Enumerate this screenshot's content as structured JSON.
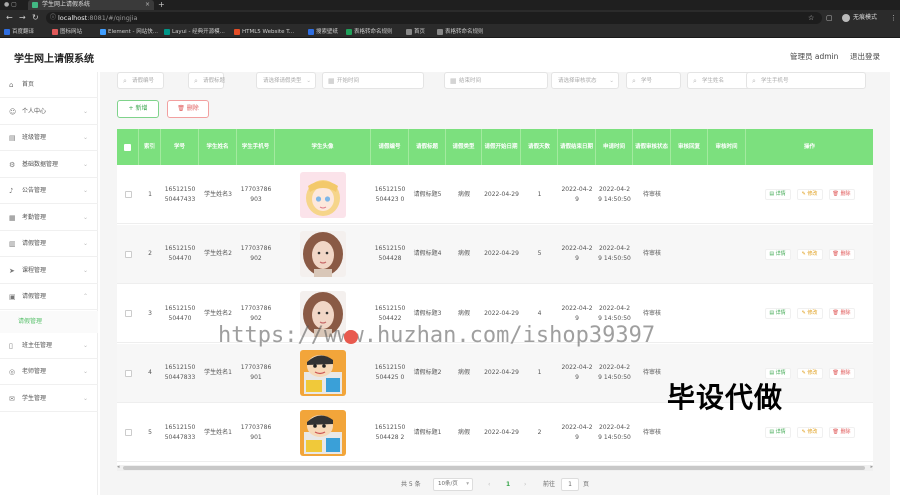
{
  "browser": {
    "tab_title": "学生网上请假系统",
    "tab_close": "×",
    "new_tab": "+",
    "url_host": "localhost",
    "url_path": ":8081/#/qingjia",
    "profile_label": "无痕模式",
    "bookmarks": [
      {
        "label": "百度翻译",
        "color": "#2f6ee0"
      },
      {
        "label": "图标网站",
        "color": "#e05a5a"
      },
      {
        "label": "Element - 网站快...",
        "color": "#409eff"
      },
      {
        "label": "Layui - 经典开源模...",
        "color": "#009688"
      },
      {
        "label": "HTML5 Website T...",
        "color": "#e44d26"
      },
      {
        "label": "搜索壁纸",
        "color": "#2f6ee0"
      },
      {
        "label": "表格转命名规则",
        "color": "#20a05a"
      },
      {
        "label": "首页",
        "color": "#888888"
      },
      {
        "label": "表格转命名规则",
        "color": "#888888"
      }
    ]
  },
  "header": {
    "title": "学生网上请假系统",
    "admin": "管理员 admin",
    "logout": "退出登录"
  },
  "sidebar": {
    "items": [
      {
        "label": "首页",
        "icon": "home-icon",
        "glyph": "⌂",
        "arrow": false
      },
      {
        "label": "个人中心",
        "icon": "user-icon",
        "glyph": "☺",
        "arrow": true
      },
      {
        "label": "班级管理",
        "icon": "clipboard-icon",
        "glyph": "▤",
        "arrow": true
      },
      {
        "label": "基础数据管理",
        "icon": "gear-icon",
        "glyph": "⚙",
        "arrow": true
      },
      {
        "label": "公告管理",
        "icon": "bell-icon",
        "glyph": "♪",
        "arrow": true
      },
      {
        "label": "考勤管理",
        "icon": "calendar-icon",
        "glyph": "▦",
        "arrow": true
      },
      {
        "label": "请假管理",
        "icon": "book-icon",
        "glyph": "▥",
        "arrow": true
      },
      {
        "label": "课程管理",
        "icon": "send-icon",
        "glyph": "➤",
        "arrow": true
      },
      {
        "label": "请假管理",
        "icon": "grid-icon",
        "glyph": "▣",
        "arrow": true,
        "expanded": true
      },
      {
        "label": "班主任管理",
        "icon": "document-icon",
        "glyph": "▯",
        "arrow": true
      },
      {
        "label": "老师管理",
        "icon": "chat-icon",
        "glyph": "◎",
        "arrow": true
      },
      {
        "label": "学生管理",
        "icon": "mail-icon",
        "glyph": "✉",
        "arrow": true
      }
    ],
    "submenu_label": "请假管理"
  },
  "filters": [
    {
      "placeholder": "请假编号",
      "type": "input"
    },
    {
      "placeholder": "请假标题",
      "type": "input"
    },
    {
      "placeholder": "请选择请假类型",
      "type": "select"
    },
    {
      "placeholder": "开始时间",
      "type": "date"
    },
    {
      "placeholder": "结束时间",
      "type": "date"
    },
    {
      "placeholder": "请选择审核状态",
      "type": "select"
    },
    {
      "placeholder": "学号",
      "type": "input"
    },
    {
      "placeholder": "学生姓名",
      "type": "input"
    },
    {
      "placeholder": "学生手机号",
      "type": "input"
    }
  ],
  "toolbar": {
    "add": "+ 新增",
    "delete": "删除"
  },
  "table": {
    "columns": [
      "",
      "索引",
      "学号",
      "学生姓名",
      "学生手机号",
      "学生头像",
      "请假编号",
      "请假标题",
      "请假类型",
      "请假开始日期",
      "请假天数",
      "请假结束日期",
      "申请时间",
      "请假审核状态",
      "审核回复",
      "审核时间",
      "操作"
    ],
    "rows": [
      {
        "index": "1",
        "student_no": "1651215050447433",
        "name": "学生姓名3",
        "phone": "17703786903",
        "avatar": "anime-girl",
        "leave_no": "16512150504423 0",
        "title": "请假标题5",
        "type": "病假",
        "start": "2022-04-29",
        "days": "1",
        "end": "2022-04-29",
        "apply_time": "2022-04-29 14:50:50",
        "status": "待审核",
        "reply": "",
        "audit_time": ""
      },
      {
        "index": "2",
        "student_no": "16512150504470",
        "name": "学生姓名2",
        "phone": "17703786902",
        "avatar": "woman",
        "leave_no": "16512150504428",
        "title": "请假标题4",
        "type": "病假",
        "start": "2022-04-29",
        "days": "5",
        "end": "2022-04-29",
        "apply_time": "2022-04-29 14:50:50",
        "status": "待审核",
        "reply": "",
        "audit_time": ""
      },
      {
        "index": "3",
        "student_no": "16512150504470",
        "name": "学生姓名2",
        "phone": "17703786902",
        "avatar": "woman",
        "leave_no": "16512150504422",
        "title": "请假标题3",
        "type": "病假",
        "start": "2022-04-29",
        "days": "4",
        "end": "2022-04-29",
        "apply_time": "2022-04-29 14:50:50",
        "status": "待审核",
        "reply": "",
        "audit_time": ""
      },
      {
        "index": "4",
        "student_no": "1651215050447833",
        "name": "学生姓名1",
        "phone": "17703786901",
        "avatar": "cartoon-boy",
        "leave_no": "16512150504425 0",
        "title": "请假标题2",
        "type": "病假",
        "start": "2022-04-29",
        "days": "1",
        "end": "2022-04-29",
        "apply_time": "2022-04-29 14:50:50",
        "status": "待审核",
        "reply": "",
        "audit_time": ""
      },
      {
        "index": "5",
        "student_no": "1651215050447833",
        "name": "学生姓名1",
        "phone": "17703786901",
        "avatar": "cartoon-boy",
        "leave_no": "16512150504428 2",
        "title": "请假标题1",
        "type": "病假",
        "start": "2022-04-29",
        "days": "2",
        "end": "2022-04-29",
        "apply_time": "2022-04-29 14:50:50",
        "status": "待审核",
        "reply": "",
        "audit_time": ""
      }
    ],
    "actions": {
      "view": "详情",
      "edit": "修改",
      "delete": "删除"
    }
  },
  "pagination": {
    "total": "共 5 条",
    "page_size": "10条/页",
    "prev": "‹",
    "current": "1",
    "next": "›",
    "goto_label": "前往",
    "goto_value": "1",
    "page_suffix": "页"
  },
  "watermark": "https://www.huzhan.com/ishop39397",
  "overlay_text": "毕设代做",
  "colors": {
    "accent": "#7ce07e",
    "green": "#3aa64d",
    "red": "#e05a5a",
    "orange": "#e0a020"
  }
}
